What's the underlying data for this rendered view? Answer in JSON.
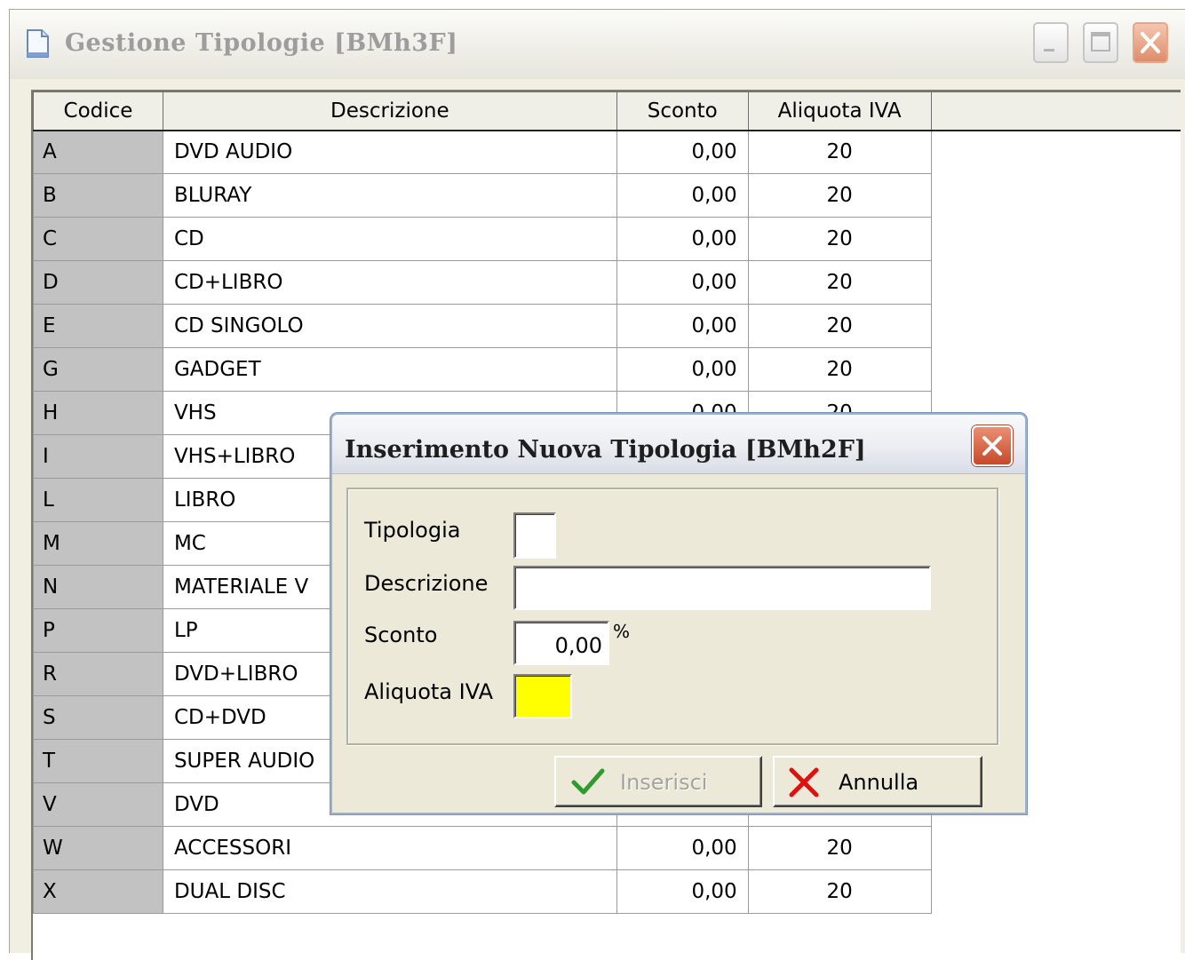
{
  "main_window": {
    "title": "Gestione Tipologie  [BMh3F]"
  },
  "grid": {
    "headers": [
      "Codice",
      "Descrizione",
      "Sconto",
      "Aliquota IVA"
    ],
    "rows": [
      {
        "codice": "A",
        "descrizione": "DVD AUDIO",
        "sconto": "0,00",
        "iva": "20"
      },
      {
        "codice": "B",
        "descrizione": "BLURAY",
        "sconto": "0,00",
        "iva": "20"
      },
      {
        "codice": "C",
        "descrizione": "CD",
        "sconto": "0,00",
        "iva": "20"
      },
      {
        "codice": "D",
        "descrizione": "CD+LIBRO",
        "sconto": "0,00",
        "iva": "20"
      },
      {
        "codice": "E",
        "descrizione": "CD SINGOLO",
        "sconto": "0,00",
        "iva": "20"
      },
      {
        "codice": "G",
        "descrizione": "GADGET",
        "sconto": "0,00",
        "iva": "20"
      },
      {
        "codice": "H",
        "descrizione": "VHS",
        "sconto": "0,00",
        "iva": "20"
      },
      {
        "codice": "I",
        "descrizione": "VHS+LIBRO",
        "sconto": "",
        "iva": ""
      },
      {
        "codice": "L",
        "descrizione": "LIBRO",
        "sconto": "",
        "iva": ""
      },
      {
        "codice": "M",
        "descrizione": "MC",
        "sconto": "",
        "iva": ""
      },
      {
        "codice": "N",
        "descrizione": "MATERIALE V",
        "sconto": "",
        "iva": ""
      },
      {
        "codice": "P",
        "descrizione": "LP",
        "sconto": "",
        "iva": ""
      },
      {
        "codice": "R",
        "descrizione": "DVD+LIBRO",
        "sconto": "",
        "iva": ""
      },
      {
        "codice": "S",
        "descrizione": "CD+DVD",
        "sconto": "",
        "iva": ""
      },
      {
        "codice": "T",
        "descrizione": "SUPER AUDIO",
        "sconto": "",
        "iva": ""
      },
      {
        "codice": "V",
        "descrizione": "DVD",
        "sconto": "",
        "iva": ""
      },
      {
        "codice": "W",
        "descrizione": "ACCESSORI",
        "sconto": "0,00",
        "iva": "20"
      },
      {
        "codice": "X",
        "descrizione": "DUAL DISC",
        "sconto": "0,00",
        "iva": "20"
      }
    ]
  },
  "dialog": {
    "title": "Inserimento Nuova Tipologia  [BMh2F]",
    "fields": {
      "tipologia_label": "Tipologia",
      "tipologia_value": "",
      "descrizione_label": "Descrizione",
      "descrizione_value": "",
      "sconto_label": "Sconto",
      "sconto_value": "0,00",
      "sconto_unit": "%",
      "iva_label": "Aliquota IVA",
      "iva_value": ""
    },
    "buttons": {
      "inserisci": "Inserisci",
      "annulla": "Annulla"
    },
    "colors": {
      "iva_field_bg": "#ffff00",
      "check_icon": "#2f9a2f",
      "cancel_icon": "#e01010"
    }
  },
  "icons": [
    "document-icon",
    "minimize-icon",
    "maximize-icon",
    "close-icon",
    "check-icon",
    "cancel-x-icon"
  ]
}
